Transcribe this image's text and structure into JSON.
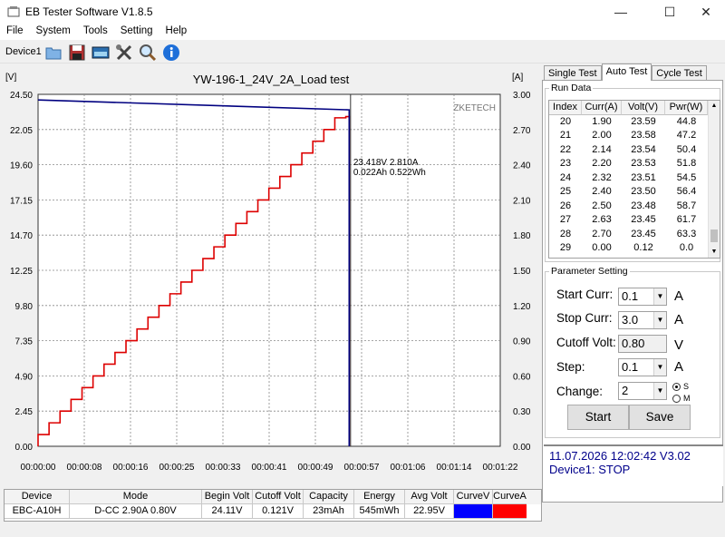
{
  "window": {
    "title": "EB Tester Software V1.8.5",
    "minimize": "—",
    "maximize": "☐",
    "close": "✕"
  },
  "menu": [
    "File",
    "System",
    "Tools",
    "Setting",
    "Help"
  ],
  "toolbar": {
    "device": "Device1",
    "buttons": [
      "open-icon",
      "save-icon",
      "screenshot-icon",
      "tools-icon",
      "search-icon",
      "info-icon"
    ]
  },
  "chart_data": {
    "type": "line",
    "title": "YW-196-1_24V_2A_Load test",
    "left_unit": "[V]",
    "right_unit": "[A]",
    "watermark": "ZKETECH",
    "y_left_ticks": [
      "24.50",
      "22.05",
      "19.60",
      "17.15",
      "14.70",
      "12.25",
      "9.80",
      "7.35",
      "4.90",
      "2.45",
      "0.00"
    ],
    "y_right_ticks": [
      "3.00",
      "2.70",
      "2.40",
      "2.10",
      "1.80",
      "1.50",
      "1.20",
      "0.90",
      "0.60",
      "0.30",
      "0.00"
    ],
    "x_ticks": [
      "00:00:00",
      "00:00:08",
      "00:00:16",
      "00:00:25",
      "00:00:33",
      "00:00:41",
      "00:00:49",
      "00:00:57",
      "00:01:06",
      "00:01:14",
      "00:01:22"
    ],
    "ylim_left": [
      0,
      24.5
    ],
    "ylim_right": [
      0,
      3.0
    ],
    "xlim_seconds": [
      0,
      82
    ],
    "series": [
      {
        "name": "CurveV",
        "color": "#000080",
        "x": [
          0,
          55.2,
          55.2
        ],
        "y": [
          24.11,
          23.42,
          0.0
        ]
      },
      {
        "name": "CurveA",
        "color": "#dd0000",
        "step_start": 0.1,
        "step_size": 0.1,
        "step_seconds": 1.95,
        "last": 2.81,
        "end_time": 55.2
      }
    ],
    "cursor": {
      "x_seconds": 55.2,
      "label1": "23.418V  2.810A",
      "label2": "0.022Ah 0.522Wh"
    },
    "grid": true
  },
  "bottom_table": {
    "headers": [
      "Device",
      "Mode",
      "Begin Volt",
      "Cutoff Volt",
      "Capacity",
      "Energy",
      "Avg Volt",
      "CurveV",
      "CurveA"
    ],
    "row": [
      "EBC-A10H",
      "D-CC  2.90A  0.80V",
      "24.11V",
      "0.121V",
      "23mAh",
      "545mWh",
      "22.95V",
      "",
      ""
    ],
    "curve_colors": [
      "#0000ff",
      "#ff0000"
    ]
  },
  "tabs": [
    "Single Test",
    "Auto Test",
    "Cycle Test"
  ],
  "run_data": {
    "label": "Run Data",
    "headers": [
      "Index",
      "Curr(A)",
      "Volt(V)",
      "Pwr(W)"
    ],
    "rows": [
      [
        "20",
        "1.90",
        "23.59",
        "44.8"
      ],
      [
        "21",
        "2.00",
        "23.58",
        "47.2"
      ],
      [
        "22",
        "2.14",
        "23.54",
        "50.4"
      ],
      [
        "23",
        "2.20",
        "23.53",
        "51.8"
      ],
      [
        "24",
        "2.32",
        "23.51",
        "54.5"
      ],
      [
        "25",
        "2.40",
        "23.50",
        "56.4"
      ],
      [
        "26",
        "2.50",
        "23.48",
        "58.7"
      ],
      [
        "27",
        "2.63",
        "23.45",
        "61.7"
      ],
      [
        "28",
        "2.70",
        "23.45",
        "63.3"
      ],
      [
        "29",
        "0.00",
        "0.12",
        "0.0"
      ]
    ]
  },
  "params": {
    "label": "Parameter Setting",
    "start_curr": {
      "label": "Start Curr:",
      "value": "0.1",
      "unit": "A"
    },
    "stop_curr": {
      "label": "Stop Curr:",
      "value": "3.0",
      "unit": "A"
    },
    "cutoff_volt": {
      "label": "Cutoff Volt:",
      "value": "0.80",
      "unit": "V"
    },
    "step": {
      "label": "Step:",
      "value": "0.1",
      "unit": "A"
    },
    "change": {
      "label": "Change:",
      "value": "2",
      "radio_s": "S",
      "radio_m": "M"
    },
    "start_btn": "Start",
    "save_btn": "Save"
  },
  "status": {
    "line1": "11.07.2026 12:02:42  V3.02",
    "line2": "Device1: STOP"
  }
}
